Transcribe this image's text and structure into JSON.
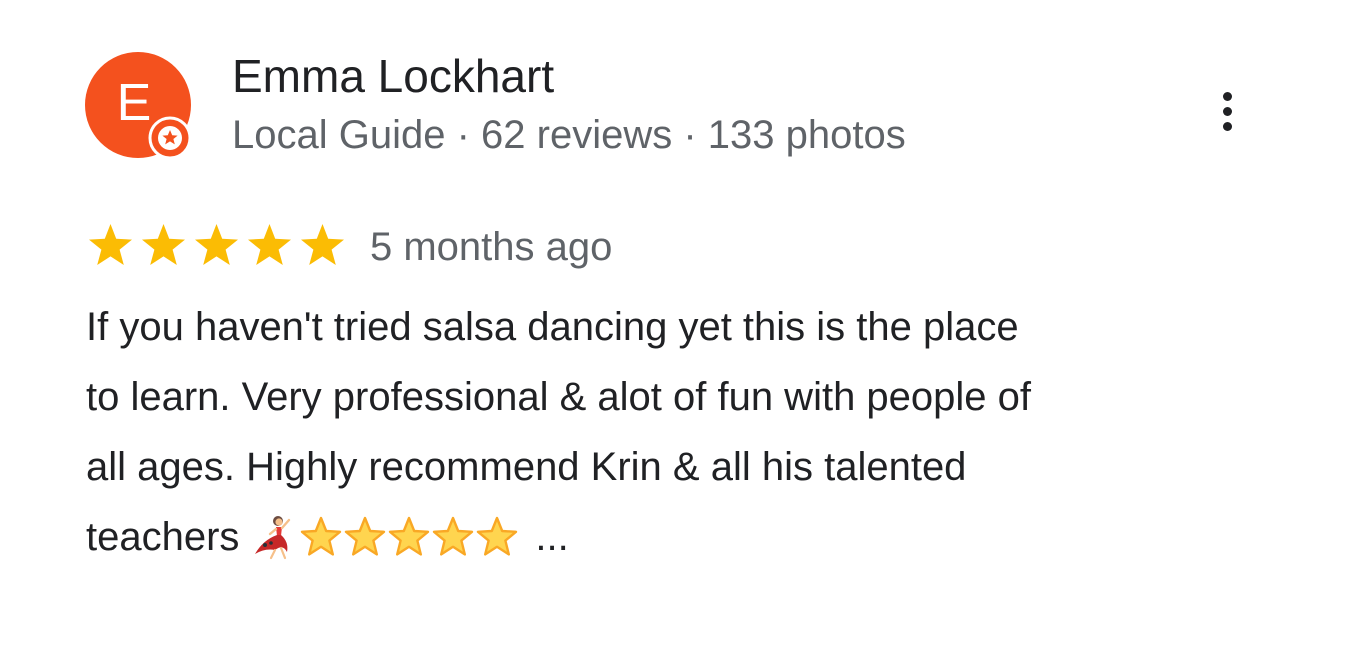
{
  "reviewer": {
    "avatar_letter": "E",
    "avatar_color": "#f4511e",
    "badge_icon": "local-guide-star-icon",
    "name": "Emma Lockhart",
    "meta": "Local Guide · 62 reviews · 133 photos"
  },
  "menu": {
    "icon": "more-vertical-icon"
  },
  "review": {
    "rating": 5,
    "rating_max": 5,
    "star_color": "#fbbc04",
    "date": "5 months ago",
    "text_lines": [
      "If you haven't tried salsa dancing yet this is the place",
      "to learn. Very professional & alot of fun with people of",
      "all ages. Highly recommend Krin & all his talented",
      "teachers"
    ],
    "emoji_icons": [
      "woman-dancing-icon",
      "star-emoji-icon",
      "star-emoji-icon",
      "star-emoji-icon",
      "star-emoji-icon",
      "star-emoji-icon"
    ],
    "ellipsis": "..."
  }
}
